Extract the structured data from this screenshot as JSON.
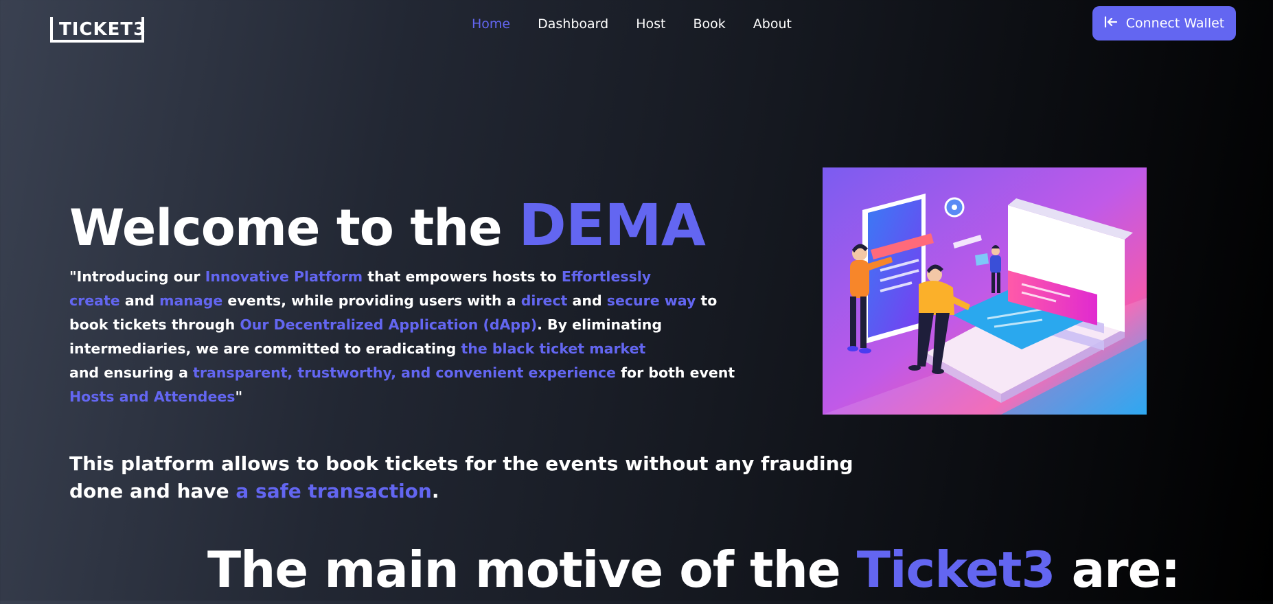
{
  "header": {
    "logo_text": "TICKET3",
    "nav": [
      "Home",
      "Dashboard",
      "Host",
      "Book",
      "About"
    ],
    "active_nav": "Home",
    "connect_label": "Connect Wallet",
    "connect_icon": "arrow-left-to-line-icon"
  },
  "hero": {
    "title_prefix": "Welcome to the",
    "title_highlight": "DEMA",
    "intro_lines": [
      [
        {
          "t": "\"Introducing our ",
          "h": false
        },
        {
          "t": "Innovative Platform",
          "h": true
        },
        {
          "t": " that empowers hosts to ",
          "h": false
        },
        {
          "t": "Effortlessly",
          "h": true
        }
      ],
      [
        {
          "t": "create",
          "h": true
        },
        {
          "t": " and ",
          "h": false
        },
        {
          "t": "manage",
          "h": true
        },
        {
          "t": " events, while providing users with a ",
          "h": false
        },
        {
          "t": "direct",
          "h": true
        },
        {
          "t": " and ",
          "h": false
        },
        {
          "t": "secure way",
          "h": true
        },
        {
          "t": " to",
          "h": false
        }
      ],
      [
        {
          "t": "book tickets through ",
          "h": false
        },
        {
          "t": "Our Decentralized Application (dApp)",
          "h": true
        },
        {
          "t": ". By eliminating",
          "h": false
        }
      ],
      [
        {
          "t": "intermediaries, we are committed to eradicating ",
          "h": false
        },
        {
          "t": "the black ticket market",
          "h": true
        }
      ],
      [
        {
          "t": "and ensuring a ",
          "h": false
        },
        {
          "t": "transparent, trustworthy, and convenient experience",
          "h": true
        },
        {
          "t": " for both event",
          "h": false
        }
      ],
      [
        {
          "t": "Hosts and Attendees",
          "h": true
        },
        {
          "t": "\"",
          "h": false
        }
      ]
    ],
    "platform_lines": [
      [
        {
          "t": "This platform allows to book tickets for the events without any frauding",
          "h": false
        }
      ],
      [
        {
          "t": "done and have ",
          "h": false
        },
        {
          "t": "a safe transaction",
          "h": true
        },
        {
          "t": ".",
          "h": false
        }
      ]
    ],
    "illustration_icon": "ticket-booking-illustration"
  },
  "motive": {
    "prefix": "The main motive of the ",
    "highlight": "Ticket3",
    "suffix": " are:"
  },
  "colors": {
    "accent": "#6366f1",
    "text": "#ffffff",
    "bg_left": "#3a4151",
    "bg_right": "#000000"
  }
}
